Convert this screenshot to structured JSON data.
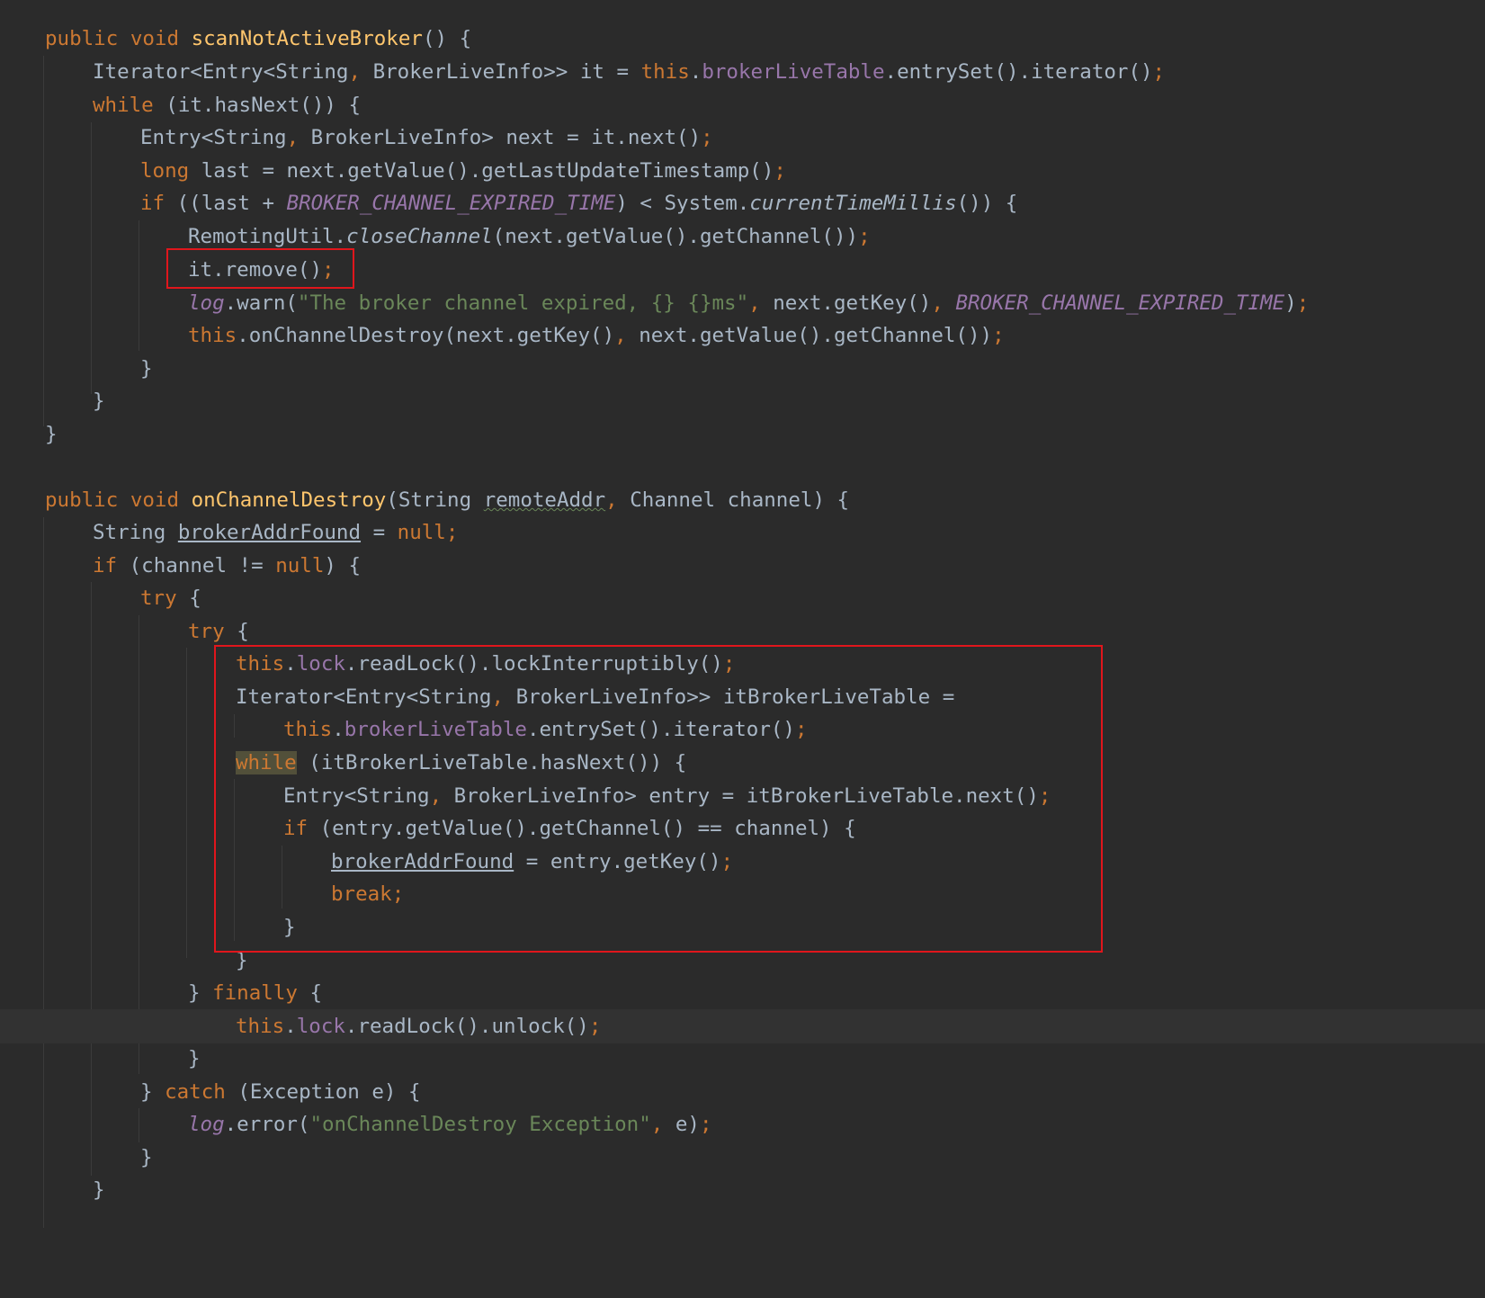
{
  "editor": {
    "theme": "darcula",
    "colors": {
      "background": "#2b2b2b",
      "text": "#a9b7c6",
      "keyword": "#cc7832",
      "method_declaration": "#ffc66d",
      "field": "#9876aa",
      "string": "#6a8759",
      "highlight_box": "#e0161c"
    },
    "lines": [
      [
        {
          "t": "public void ",
          "c": "kw"
        },
        {
          "t": "scanNotActiveBroker",
          "c": "fn"
        },
        {
          "t": "() {"
        }
      ],
      [
        {
          "t": "Iterator<Entry<String"
        },
        {
          "t": ", ",
          "c": "punc"
        },
        {
          "t": "BrokerLiveInfo>> it = "
        },
        {
          "t": "this",
          "c": "kw"
        },
        {
          "t": "."
        },
        {
          "t": "brokerLiveTable",
          "c": "fld"
        },
        {
          "t": ".entrySet().iterator()"
        },
        {
          "t": ";",
          "c": "punc"
        }
      ],
      [
        {
          "t": "while ",
          "c": "kw"
        },
        {
          "t": "(it.hasNext()) {"
        }
      ],
      [
        {
          "t": "Entry<String"
        },
        {
          "t": ", ",
          "c": "punc"
        },
        {
          "t": "BrokerLiveInfo> next = it.next()"
        },
        {
          "t": ";",
          "c": "punc"
        }
      ],
      [
        {
          "t": "long ",
          "c": "kw"
        },
        {
          "t": "last = next.getValue().getLastUpdateTimestamp()"
        },
        {
          "t": ";",
          "c": "punc"
        }
      ],
      [
        {
          "t": "if ",
          "c": "kw"
        },
        {
          "t": "((last + "
        },
        {
          "t": "BROKER_CHANNEL_EXPIRED_TIME",
          "c": "cst"
        },
        {
          "t": ") < System."
        },
        {
          "t": "currentTimeMillis",
          "c": "it"
        },
        {
          "t": "()) {"
        }
      ],
      [
        {
          "t": "RemotingUtil."
        },
        {
          "t": "closeChannel",
          "c": "it"
        },
        {
          "t": "(next.getValue().getChannel())"
        },
        {
          "t": ";",
          "c": "punc"
        }
      ],
      [
        {
          "t": "it.remove()"
        },
        {
          "t": ";",
          "c": "punc"
        }
      ],
      [
        {
          "t": "log",
          "c": "cst"
        },
        {
          "t": ".warn("
        },
        {
          "t": "\"The broker channel expired, {} {}ms\"",
          "c": "str"
        },
        {
          "t": ", ",
          "c": "punc"
        },
        {
          "t": "next.getKey()"
        },
        {
          "t": ", ",
          "c": "punc"
        },
        {
          "t": "BROKER_CHANNEL_EXPIRED_TIME",
          "c": "cst"
        },
        {
          "t": ")"
        },
        {
          "t": ";",
          "c": "punc"
        }
      ],
      [
        {
          "t": "this",
          "c": "kw"
        },
        {
          "t": ".onChannelDestroy(next.getKey()"
        },
        {
          "t": ", ",
          "c": "punc"
        },
        {
          "t": "next.getValue().getChannel())"
        },
        {
          "t": ";",
          "c": "punc"
        }
      ],
      [
        {
          "t": "}"
        }
      ],
      [
        {
          "t": "}"
        }
      ],
      [
        {
          "t": "}"
        }
      ],
      [],
      [
        {
          "t": "public void ",
          "c": "kw"
        },
        {
          "t": "onChannelDestroy",
          "c": "fn"
        },
        {
          "t": "(String "
        },
        {
          "t": "remoteAddr",
          "c": "wavy"
        },
        {
          "t": ", ",
          "c": "punc"
        },
        {
          "t": "Channel channel) {"
        }
      ],
      [
        {
          "t": "String "
        },
        {
          "t": "brokerAddrFound",
          "c": "ul"
        },
        {
          "t": " = "
        },
        {
          "t": "null",
          "c": "kw"
        },
        {
          "t": ";",
          "c": "punc"
        }
      ],
      [
        {
          "t": "if ",
          "c": "kw"
        },
        {
          "t": "(channel != "
        },
        {
          "t": "null",
          "c": "kw"
        },
        {
          "t": ") {"
        }
      ],
      [
        {
          "t": "try ",
          "c": "kw"
        },
        {
          "t": "{"
        }
      ],
      [
        {
          "t": "try ",
          "c": "kw"
        },
        {
          "t": "{"
        }
      ],
      [
        {
          "t": "this",
          "c": "kw"
        },
        {
          "t": "."
        },
        {
          "t": "lock",
          "c": "fld"
        },
        {
          "t": ".readLock().lockInterruptibly()"
        },
        {
          "t": ";",
          "c": "punc"
        }
      ],
      [
        {
          "t": "Iterator<Entry<String"
        },
        {
          "t": ", ",
          "c": "punc"
        },
        {
          "t": "BrokerLiveInfo>> itBrokerLiveTable ="
        }
      ],
      [
        {
          "t": "this",
          "c": "kw"
        },
        {
          "t": "."
        },
        {
          "t": "brokerLiveTable",
          "c": "fld"
        },
        {
          "t": ".entrySet().iterator()"
        },
        {
          "t": ";",
          "c": "punc"
        }
      ],
      [
        {
          "t": "while",
          "c": "kw hl"
        },
        {
          "t": " (itBrokerLiveTable.hasNext()) {"
        }
      ],
      [
        {
          "t": "Entry<String"
        },
        {
          "t": ", ",
          "c": "punc"
        },
        {
          "t": "BrokerLiveInfo> entry = itBrokerLiveTable.next()"
        },
        {
          "t": ";",
          "c": "punc"
        }
      ],
      [
        {
          "t": "if ",
          "c": "kw"
        },
        {
          "t": "(entry.getValue().getChannel() == channel) {"
        }
      ],
      [
        {
          "t": "brokerAddrFound",
          "c": "ul"
        },
        {
          "t": " = entry.getKey()"
        },
        {
          "t": ";",
          "c": "punc"
        }
      ],
      [
        {
          "t": "break",
          "c": "kw"
        },
        {
          "t": ";",
          "c": "punc"
        }
      ],
      [
        {
          "t": "}"
        }
      ],
      [
        {
          "t": "}"
        }
      ],
      [
        {
          "t": "} "
        },
        {
          "t": "finally ",
          "c": "kw"
        },
        {
          "t": "{"
        }
      ],
      [
        {
          "t": "this",
          "c": "kw"
        },
        {
          "t": "."
        },
        {
          "t": "lock",
          "c": "fld"
        },
        {
          "t": ".readLock().unlock()"
        },
        {
          "t": ";",
          "c": "punc"
        }
      ],
      [
        {
          "t": "}"
        }
      ],
      [
        {
          "t": "} "
        },
        {
          "t": "catch ",
          "c": "kw"
        },
        {
          "t": "(Exception e) {"
        }
      ],
      [
        {
          "t": "log",
          "c": "cst"
        },
        {
          "t": ".error("
        },
        {
          "t": "\"onChannelDestroy Exception\"",
          "c": "str"
        },
        {
          "t": ", ",
          "c": "punc"
        },
        {
          "t": "e)"
        },
        {
          "t": ";",
          "c": "punc"
        }
      ],
      [
        {
          "t": "}"
        }
      ],
      [
        {
          "t": "}"
        }
      ]
    ]
  }
}
